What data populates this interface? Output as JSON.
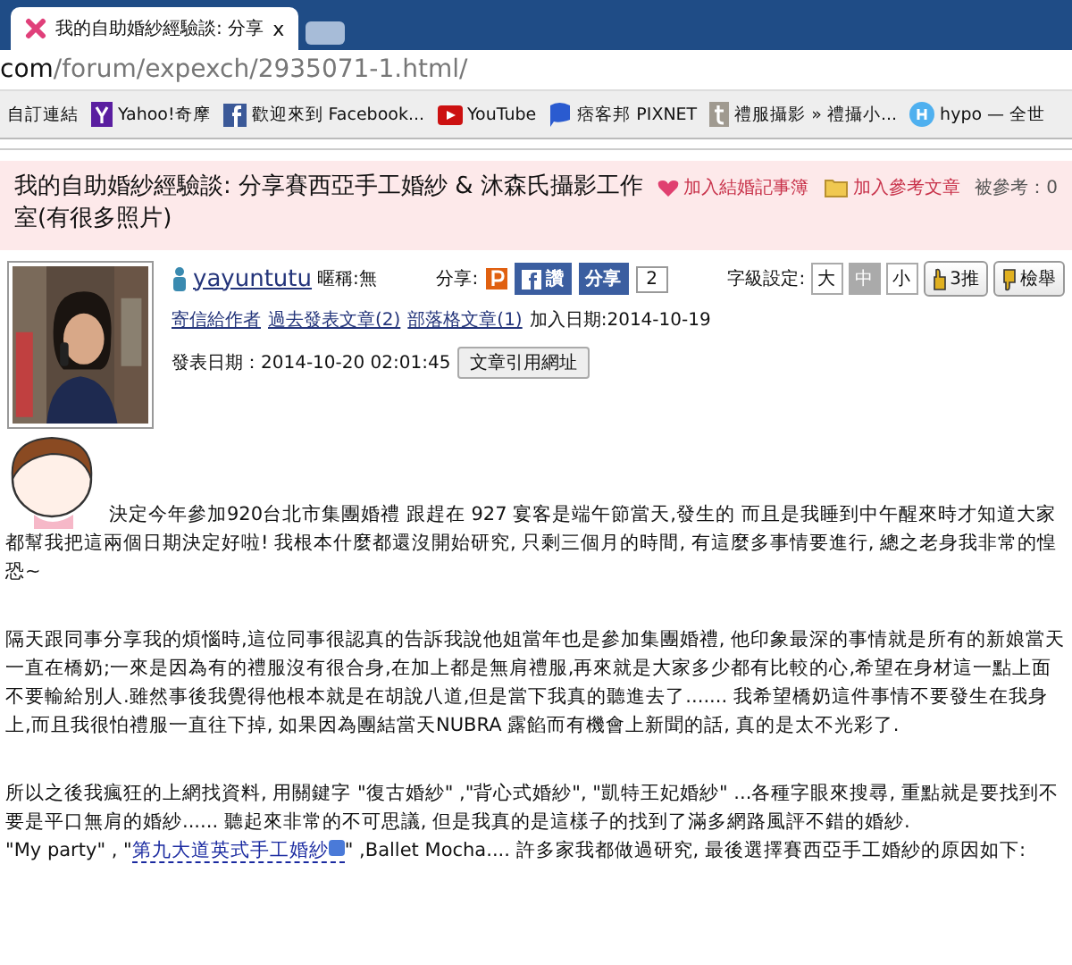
{
  "browser": {
    "tab_title": "我的自助婚紗經驗談: 分享",
    "tab_close": "x",
    "url_host": "com",
    "url_path": "/forum/expexch/2935071-1.html/",
    "bookmarks": [
      {
        "label": "自訂連結",
        "kind": "none"
      },
      {
        "label": "Yahoo!奇摩",
        "kind": "yahoo"
      },
      {
        "label": "歡迎來到 Facebook...",
        "kind": "facebook"
      },
      {
        "label": "YouTube",
        "kind": "youtube"
      },
      {
        "label": "痞客邦 PIXNET",
        "kind": "pixnet"
      },
      {
        "label": "禮服攝影 » 禮攝小...",
        "kind": "tumblr"
      },
      {
        "label": "hypo — 全世",
        "kind": "hypo"
      }
    ]
  },
  "article": {
    "title": "我的自助婚紗經驗談: 分享賽西亞手工婚紗 & 沐森氏攝影工作室(有很多照片)",
    "actions": [
      {
        "label": "加入結婚記事簿",
        "kind": "heart"
      },
      {
        "label": "加入參考文章",
        "kind": "folder"
      }
    ],
    "ref_count": "被參考：0"
  },
  "author": {
    "name": "yayuntutu",
    "nickname": "暱稱:無",
    "links": [
      "寄信給作者",
      "過去發表文章(2)",
      "部落格文章(1)"
    ],
    "joined": "加入日期:2014-10-19",
    "posted": "發表日期：2014-10-20 02:01:45",
    "cite_button": "文章引用網址"
  },
  "share": {
    "label": "分享:",
    "fb_like": "讚",
    "fb_share": "分享",
    "share_count": "2"
  },
  "font_size": {
    "label": "字級設定:",
    "options": [
      {
        "label": "大",
        "selected": false
      },
      {
        "label": "中",
        "selected": true
      },
      {
        "label": "小",
        "selected": false
      }
    ]
  },
  "like_button": "3推",
  "report_button": "檢舉",
  "body": [
    "決定今年參加920台北市集團婚禮 跟趕在 927 宴客是端午節當天,發生的 而且是我睡到中午醒來時才知道大家都幫我把這兩個日期決定好啦! 我根本什麼都還沒開始研究, 只剩三個月的時間, 有這麼多事情要進行, 總之老身我非常的惶恐~",
    "隔天跟同事分享我的煩惱時,這位同事很認真的告訴我說他姐當年也是參加集團婚禮, 他印象最深的事情就是所有的新娘當天一直在橋奶;一來是因為有的禮服沒有很合身,在加上都是無肩禮服,再來就是大家多少都有比較的心,希望在身材這一點上面不要輸給別人.雖然事後我覺得他根本就是在胡說八道,但是當下我真的聽進去了....... 我希望橋奶這件事情不要發生在我身上,而且我很怕禮服一直往下掉, 如果因為團結當天NUBRA 露餡而有機會上新聞的話, 真的是太不光彩了.",
    "所以之後我瘋狂的上網找資料, 用關鍵字 \"復古婚紗\" ,\"背心式婚紗\", \"凱特王妃婚紗\" ...各種字眼來搜尋, 重點就是要找到不要是平口無肩的婚紗...... 聽起來非常的不可思議, 但是我真的是這樣子的找到了滿多網路風評不錯的婚紗."
  ],
  "closing": {
    "before": "\"My party\" , \"",
    "link": "第九大道英式手工婚紗",
    "after": "\" ,Ballet Mocha.... 許多家我都做過研究, 最後選擇賽西亞手工婚紗的原因如下:"
  }
}
